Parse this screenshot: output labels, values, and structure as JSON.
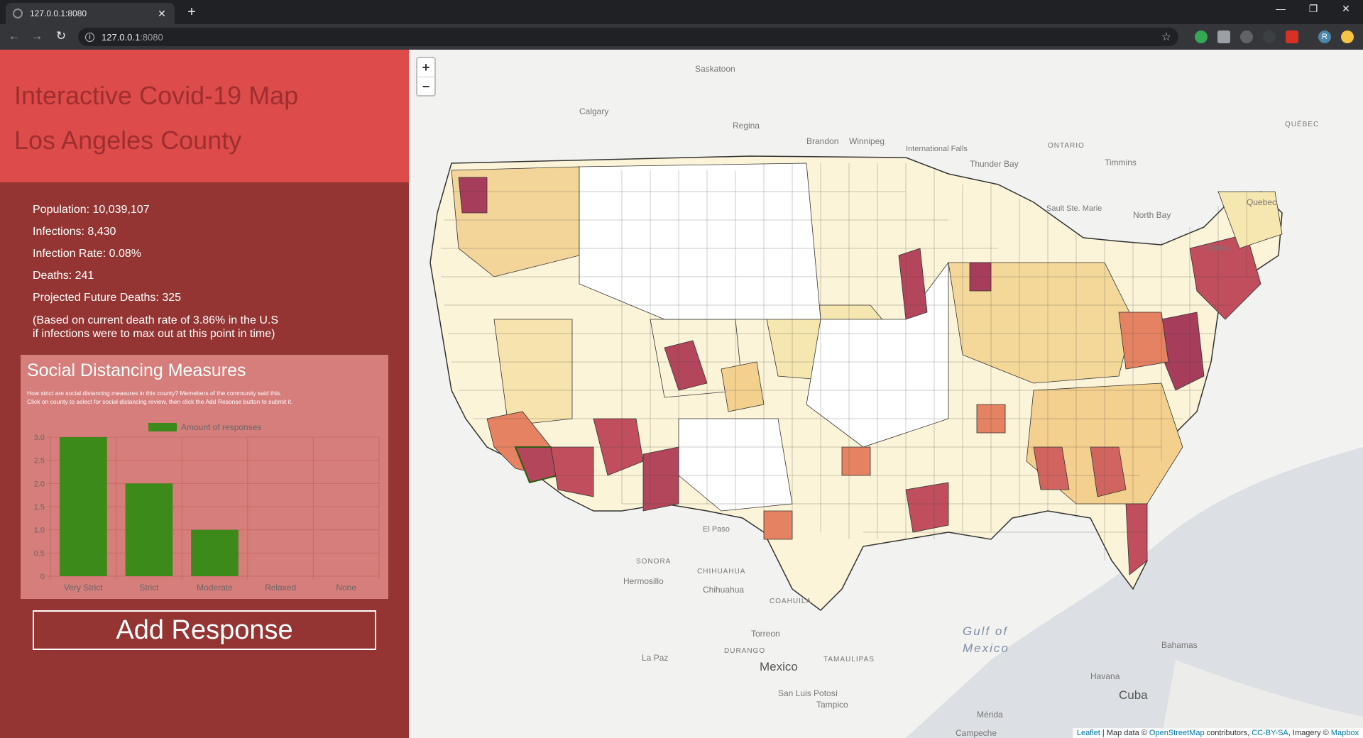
{
  "browser": {
    "tab_title": "127.0.0.1:8080",
    "url_host": "127.0.0.1",
    "url_port": ":8080",
    "profile_initial": "R"
  },
  "header": {
    "title": "Interactive Covid-19 Map",
    "county": "Los Angeles County"
  },
  "stats": {
    "population": "Population: 10,039,107",
    "infections": "Infections: 8,430",
    "infection_rate": "Infection Rate: 0.08%",
    "deaths": "Deaths: 241",
    "projected": "Projected Future Deaths: 325",
    "note_line1": "(Based on current death rate of 3.86% in the U.S",
    "note_line2": "if infections were to max out at this point in time)"
  },
  "social_distancing": {
    "title": "Social Distancing Measures",
    "desc_line1": "How strict are social distancing measures in this county? Memebers of the community said this.",
    "desc_line2": "Click on county to select for social distancing review, then click the Add Resonse button to submit it."
  },
  "chart_data": {
    "type": "bar",
    "categories": [
      "Very Strict",
      "Strict",
      "Moderate",
      "Relaxed",
      "None"
    ],
    "series": [
      {
        "name": "Amount of responses",
        "values": [
          3,
          2,
          1,
          0,
          0
        ],
        "color": "#3b8a1a"
      }
    ],
    "ylim": [
      0,
      3.0
    ],
    "yticks": [
      "0",
      "0.5",
      "1.0",
      "1.5",
      "2.0",
      "2.5",
      "3.0"
    ],
    "legend": "top-center",
    "grid": true
  },
  "add_button": "Add Response",
  "map": {
    "zoom_in": "+",
    "zoom_out": "−",
    "attribution": {
      "leaflet": "Leaflet",
      "sep1": " | Map data © ",
      "osm": "OpenStreetMap",
      "contrib": " contributors, ",
      "cc": "CC-BY-SA",
      "imagery": ", Imagery © ",
      "mapbox": "Mapbox"
    },
    "labels": {
      "saskatoon": "Saskatoon",
      "calgary": "Calgary",
      "regina": "Regina",
      "brandon": "Brandon",
      "winnipeg": "Winnipeg",
      "ontario": "ONTARIO",
      "quebec_prov": "QUÉBEC",
      "thunder_bay": "Thunder Bay",
      "timmins": "Timmins",
      "quebec": "Quebec",
      "north_bay": "North Bay",
      "ottawa": "Ottawa",
      "gulf": "Gulf of",
      "mexico_sea": "Mexico",
      "mexico": "Mexico",
      "sonora": "SONORA",
      "chihuahua_st": "CHIHUAHUA",
      "chihuahua": "Chihuahua",
      "coahuila": "COAHUILA",
      "hermosillo": "Hermosillo",
      "durango": "DURANGO",
      "torreon": "Torreon",
      "tamaulipas": "TAMAULIPAS",
      "san_luis": "San Luis Potosí",
      "tampico": "Tampico",
      "la_paz": "La Paz",
      "bahamas": "Bahamas",
      "havana": "Havana",
      "cuba": "Cuba",
      "merida": "Mérida",
      "campeche": "Campeche",
      "intl_falls": "International Falls",
      "sault": "Sault Ste. Marie",
      "el_paso": "El Paso"
    }
  }
}
